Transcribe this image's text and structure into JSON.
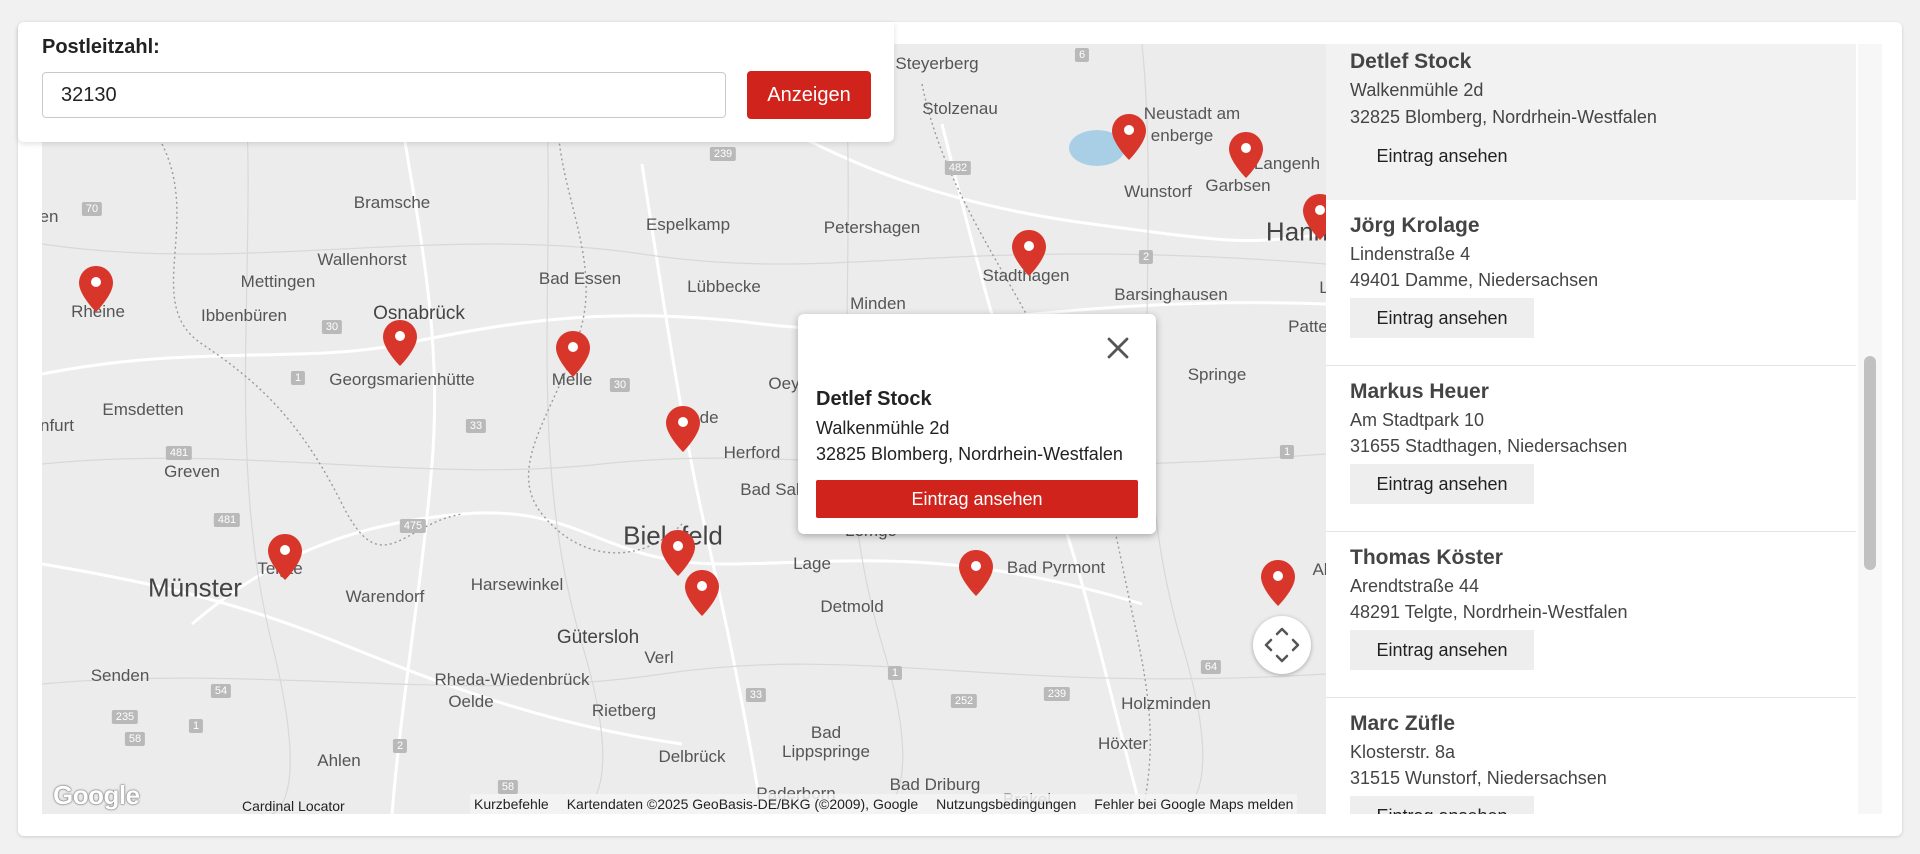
{
  "search": {
    "label": "Postleitzahl:",
    "value": "32130",
    "button_label": "Anzeigen"
  },
  "popup": {
    "name": "Detlef Stock",
    "street": "Walkenmühle 2d",
    "city": "32825 Blomberg, Nordrhein-Westfalen",
    "button_label": "Eintrag ansehen"
  },
  "map": {
    "places": [
      "Steyerberg",
      "Stolzenau",
      "Neustadt am",
      "enberge",
      "Langenh",
      "Wunstorf",
      "Garbsen",
      "Hann",
      "Bramsche",
      "Espelkamp",
      "Petershagen",
      "Wallenhorst",
      "Bad Essen",
      "Lübbecke",
      "Stadthagen",
      "Barsinghausen",
      "Mettingen",
      "Minden",
      "Rheine",
      "Ibbenbüren",
      "Osnabrück",
      "Patte",
      "Georgsmarienhütte",
      "Melle",
      "Bünde",
      "Oey",
      "Springe",
      "Emsdetten",
      "nfurt",
      "Herford",
      "Greven",
      "Bad Sal",
      "Bielefeld",
      "Lemgo",
      "Münster",
      "Telgte",
      "Warendorf",
      "Harsewinkel",
      "Lage",
      "Bad Pyrmont",
      "Al",
      "Detmold",
      "Gütersloh",
      "Verl",
      "Senden",
      "Rheda-Wiedenbrück",
      "Oelde",
      "Rietberg",
      "Holzminden",
      "Bad",
      "Lippspringe",
      "Ahlen",
      "Delbrück",
      "Höxter",
      "Paderborn",
      "Bad Driburg",
      "Brakel",
      "en",
      "L"
    ],
    "google_logo": "Google",
    "cardinal_label": "Cardinal Locator",
    "attribution": {
      "shortcuts": "Kurzbefehle",
      "map_data": "Kartendaten ©2025 GeoBasis-DE/BKG (©2009), Google",
      "terms": "Nutzungsbedingungen",
      "report": "Fehler bei Google Maps melden"
    },
    "marker_color": "#d9362b",
    "marker_count": 14
  },
  "entries": [
    {
      "name": "Detlef Stock",
      "street": "Walkenmühle 2d",
      "city": "32825 Blomberg, Nordrhein-Westfalen",
      "button_label": "Eintrag ansehen"
    },
    {
      "name": "Jörg Krolage",
      "street": "Lindenstraße 4",
      "city": "49401 Damme, Niedersachsen",
      "button_label": "Eintrag ansehen"
    },
    {
      "name": "Markus Heuer",
      "street": "Am Stadtpark 10",
      "city": "31655 Stadthagen, Niedersachsen",
      "button_label": "Eintrag ansehen"
    },
    {
      "name": "Thomas Köster",
      "street": "Arendtstraße 44",
      "city": "48291 Telgte, Nordrhein-Westfalen",
      "button_label": "Eintrag ansehen"
    },
    {
      "name": "Marc Züfle",
      "street": "Klosterstr. 8a",
      "city": "31515 Wunstorf, Niedersachsen",
      "button_label": "Eintrag ansehen"
    }
  ],
  "colors": {
    "accent": "#d0231c",
    "background": "#f1f1f1",
    "map_background": "#ececec"
  }
}
